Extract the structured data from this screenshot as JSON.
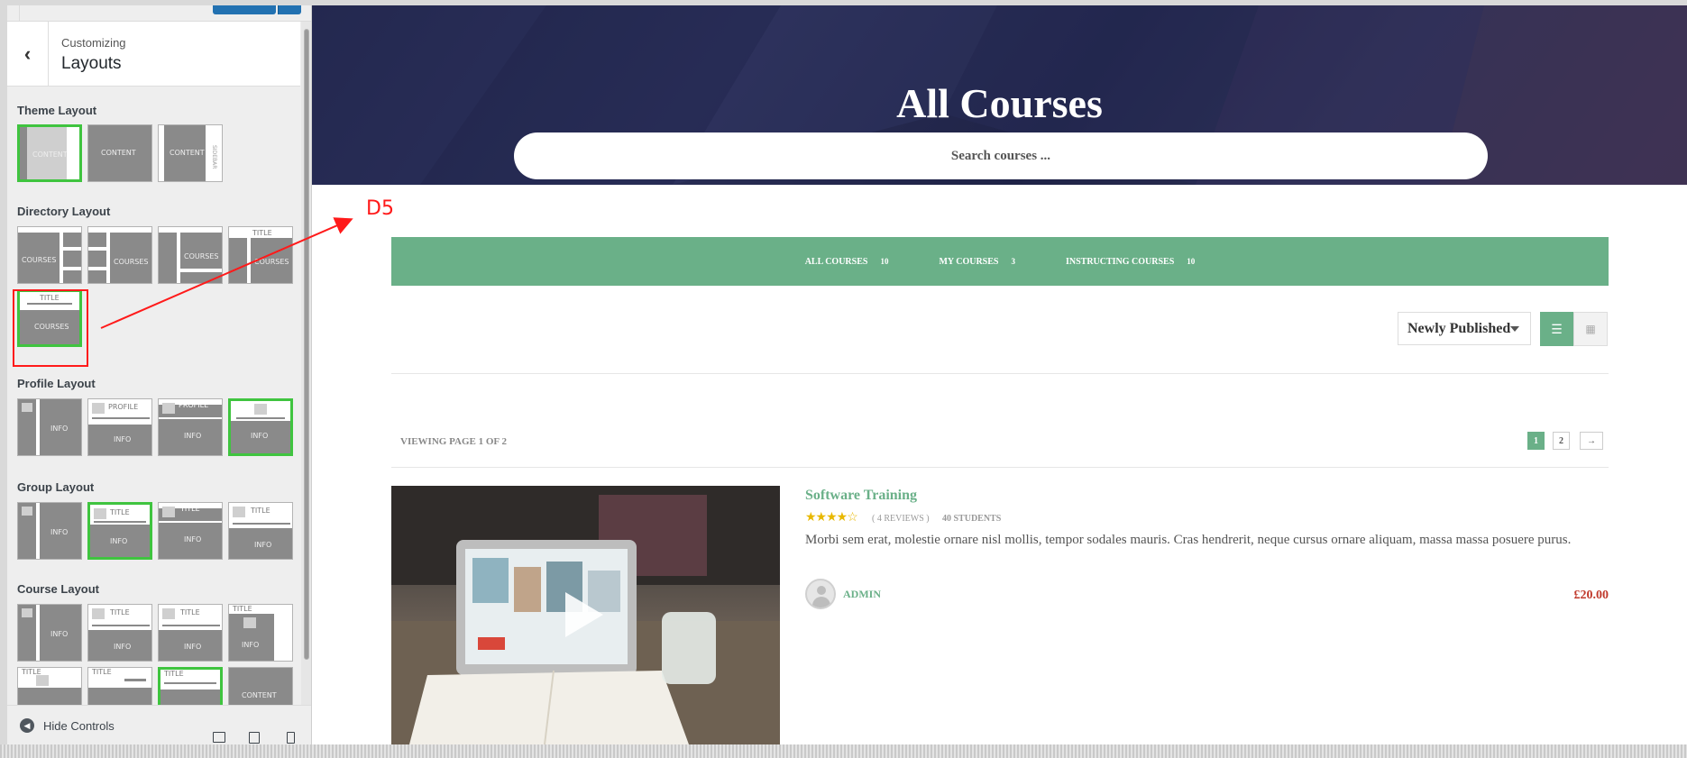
{
  "customizer": {
    "breadcrumb": "Customizing",
    "title": "Layouts",
    "sections": {
      "theme": "Theme Layout",
      "directory": "Directory Layout",
      "profile": "Profile Layout",
      "group": "Group Layout",
      "course": "Course Layout"
    },
    "thumb_labels": {
      "content": "CONTENT",
      "courses": "COURSES",
      "title": "TITLE",
      "info": "INFO",
      "profile": "PROFILE",
      "sidebar": "SIDEBAR"
    },
    "hide_controls": "Hide Controls",
    "colors": {
      "selected": "#3fc43f",
      "publish": "#2271b1"
    }
  },
  "annotation": {
    "label": "D5",
    "color": "#ff1a1a"
  },
  "preview": {
    "hero_title": "All Courses",
    "search_placeholder": "Search courses ...",
    "tabs": [
      {
        "label": "ALL COURSES",
        "count": "10"
      },
      {
        "label": "MY COURSES",
        "count": "3"
      },
      {
        "label": "INSTRUCTING COURSES",
        "count": "10"
      }
    ],
    "sort_selected": "Newly Published",
    "viewing": "VIEWING PAGE 1 OF 2",
    "pagination": [
      "1",
      "2",
      "→"
    ],
    "course": {
      "title": "Software Training",
      "stars": "★★★★☆",
      "rating": 4,
      "reviews": "( 4 REVIEWS )",
      "students": "40 STUDENTS",
      "description": "Morbi sem erat, molestie ornare nisl mollis, tempor sodales mauris. Cras hendrerit, neque cursus ornare aliquam, massa massa posuere purus.",
      "author": "ADMIN",
      "price": "£20.00"
    },
    "colors": {
      "accent": "#6ab088",
      "price": "#c0392b",
      "hero": "#1e2244"
    }
  }
}
